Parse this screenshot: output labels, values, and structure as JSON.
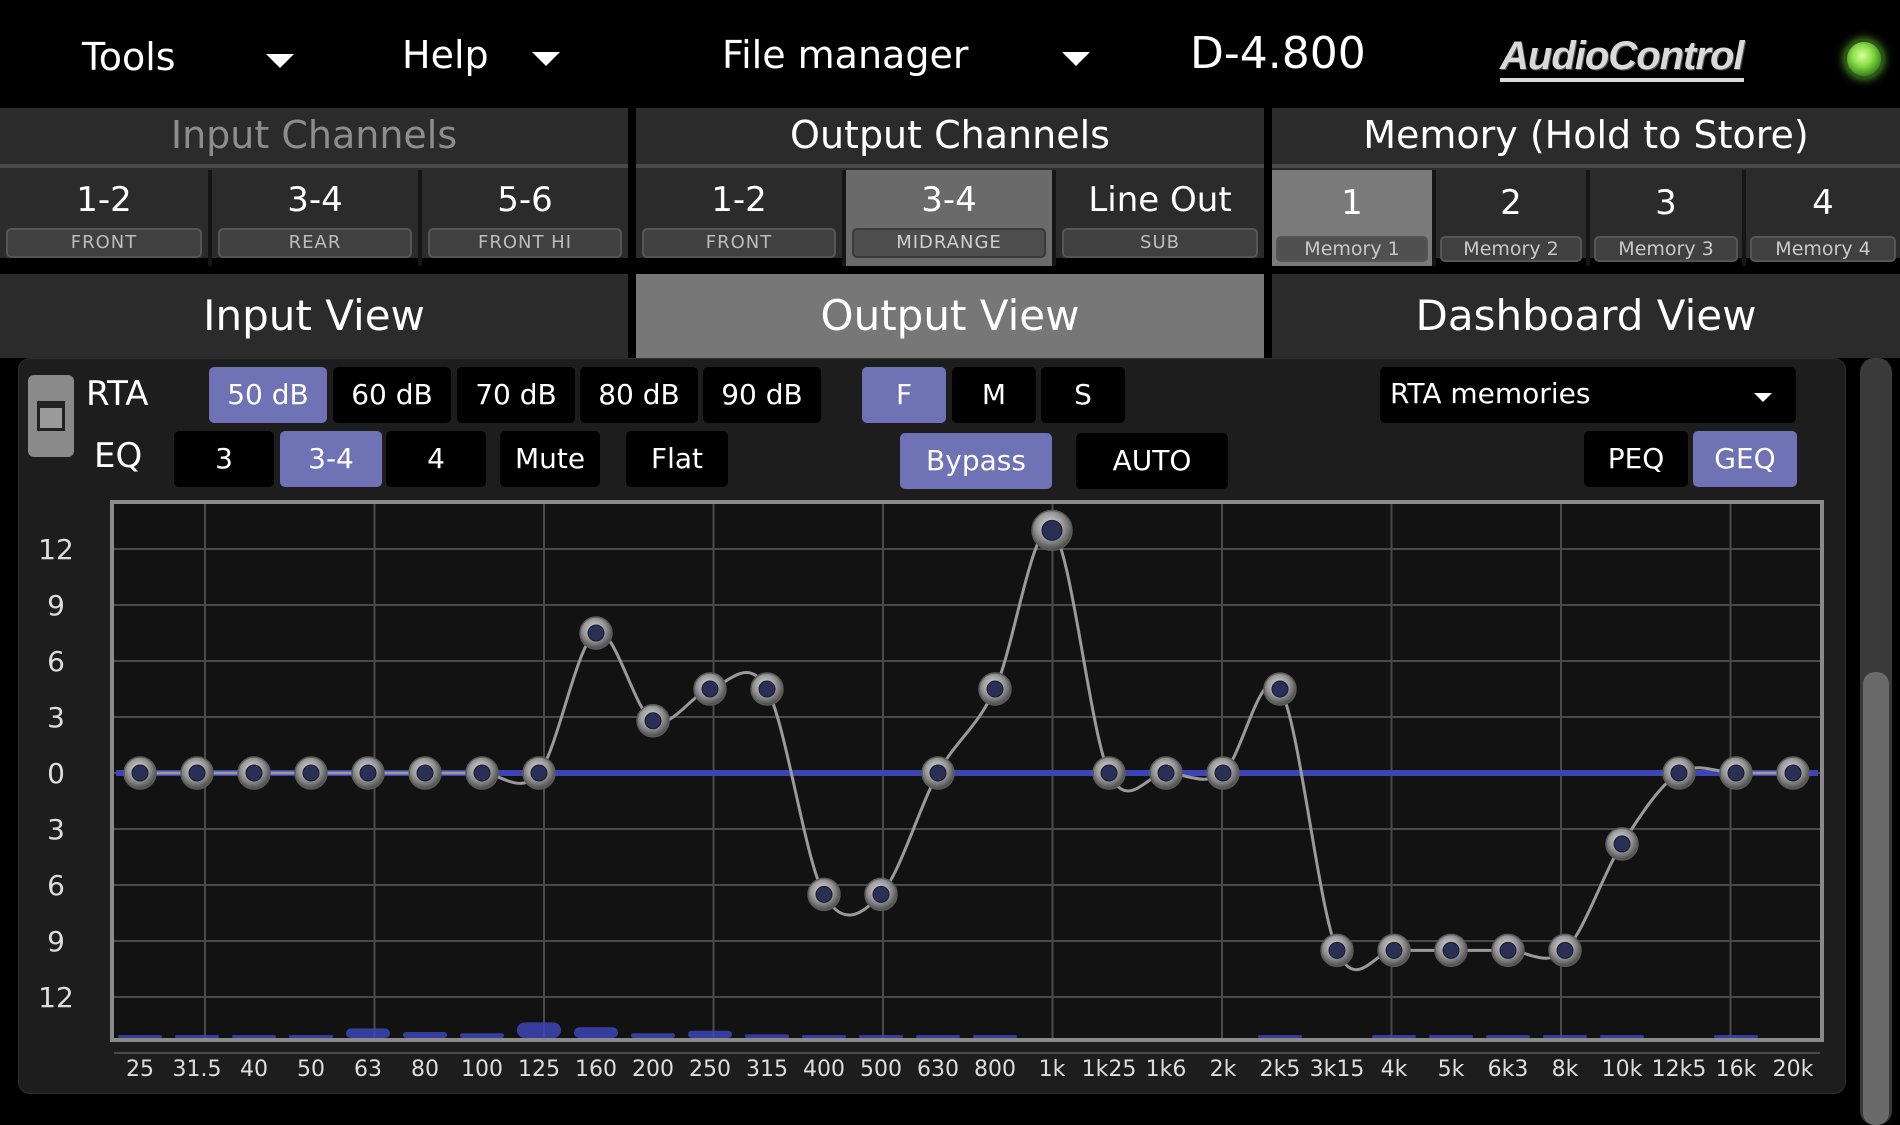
{
  "topbar": {
    "tools_label": "Tools",
    "help_label": "Help",
    "file_manager_label": "File manager",
    "model": "D-4.800",
    "brand": "AudioControl",
    "led_color": "#7fd43a"
  },
  "input_channels": {
    "title": "Input Channels",
    "buttons": [
      {
        "num": "1-2",
        "sub": "FRONT"
      },
      {
        "num": "3-4",
        "sub": "REAR"
      },
      {
        "num": "5-6",
        "sub": "FRONT HI"
      }
    ]
  },
  "output_channels": {
    "title": "Output Channels",
    "selected": "3-4",
    "buttons": [
      {
        "num": "1-2",
        "sub": "FRONT"
      },
      {
        "num": "3-4",
        "sub": "MIDRANGE"
      },
      {
        "num": "Line Out",
        "sub": "SUB"
      }
    ]
  },
  "memory": {
    "title": "Memory (Hold to Store)",
    "selected": "1",
    "buttons": [
      {
        "num": "1",
        "sub": "Memory 1"
      },
      {
        "num": "2",
        "sub": "Memory 2"
      },
      {
        "num": "3",
        "sub": "Memory 3"
      },
      {
        "num": "4",
        "sub": "Memory 4"
      }
    ]
  },
  "views": {
    "input": "Input View",
    "output": "Output View",
    "dashboard": "Dashboard View",
    "selected": "Output View"
  },
  "rta": {
    "label": "RTA",
    "ranges": [
      "50 dB",
      "60 dB",
      "70 dB",
      "80 dB",
      "90 dB"
    ],
    "selected_range": "50 dB",
    "speed": [
      "F",
      "M",
      "S"
    ],
    "selected_speed": "F",
    "memories_label": "RTA memories"
  },
  "eq": {
    "label": "EQ",
    "channels": [
      "3",
      "3-4",
      "4"
    ],
    "selected_channel": "3-4",
    "mute": "Mute",
    "flat": "Flat",
    "bypass": "Bypass",
    "bypass_on": true,
    "auto": "AUTO",
    "peq": "PEQ",
    "geq": "GEQ",
    "selected_mode": "GEQ"
  },
  "accent_color": "#6f72b4",
  "chart_data": {
    "type": "line",
    "title": "",
    "xlabel": "",
    "ylabel": "",
    "y_ticks": [
      "12",
      "9",
      "6",
      "3",
      "0",
      "3",
      "6",
      "9",
      "12"
    ],
    "ylim": [
      -14,
      14
    ],
    "x": [
      "25",
      "31.5",
      "40",
      "50",
      "63",
      "80",
      "100",
      "125",
      "160",
      "200",
      "250",
      "315",
      "400",
      "500",
      "630",
      "800",
      "1k",
      "1k25",
      "1k6",
      "2k",
      "2k5",
      "3k15",
      "4k",
      "5k",
      "6k3",
      "8k",
      "10k",
      "12k5",
      "16k",
      "20k"
    ],
    "series": [
      {
        "values": [
          0,
          0,
          0,
          0,
          0,
          0,
          0,
          0,
          7.5,
          2.8,
          4.5,
          4.5,
          -6.5,
          -6.5,
          0,
          4.5,
          13,
          0,
          0,
          0,
          4.5,
          -9.5,
          -9.5,
          -9.5,
          -9.5,
          -9.5,
          -3.8,
          0,
          0,
          0
        ]
      }
    ],
    "rta_levels": [
      0.05,
      0.05,
      0.05,
      0.1,
      0.4,
      0.25,
      0.2,
      0.65,
      0.45,
      0.2,
      0.3,
      0.15,
      0.05,
      0.05,
      0.05,
      0.05,
      0,
      0,
      0,
      0,
      0.05,
      0,
      0.05,
      0.1,
      0.1,
      0.1,
      0.05,
      0,
      0.05,
      0
    ],
    "reference_line": 0,
    "grid": true,
    "line_color": "#9a9a9a",
    "ref_color": "#3d45b5"
  }
}
